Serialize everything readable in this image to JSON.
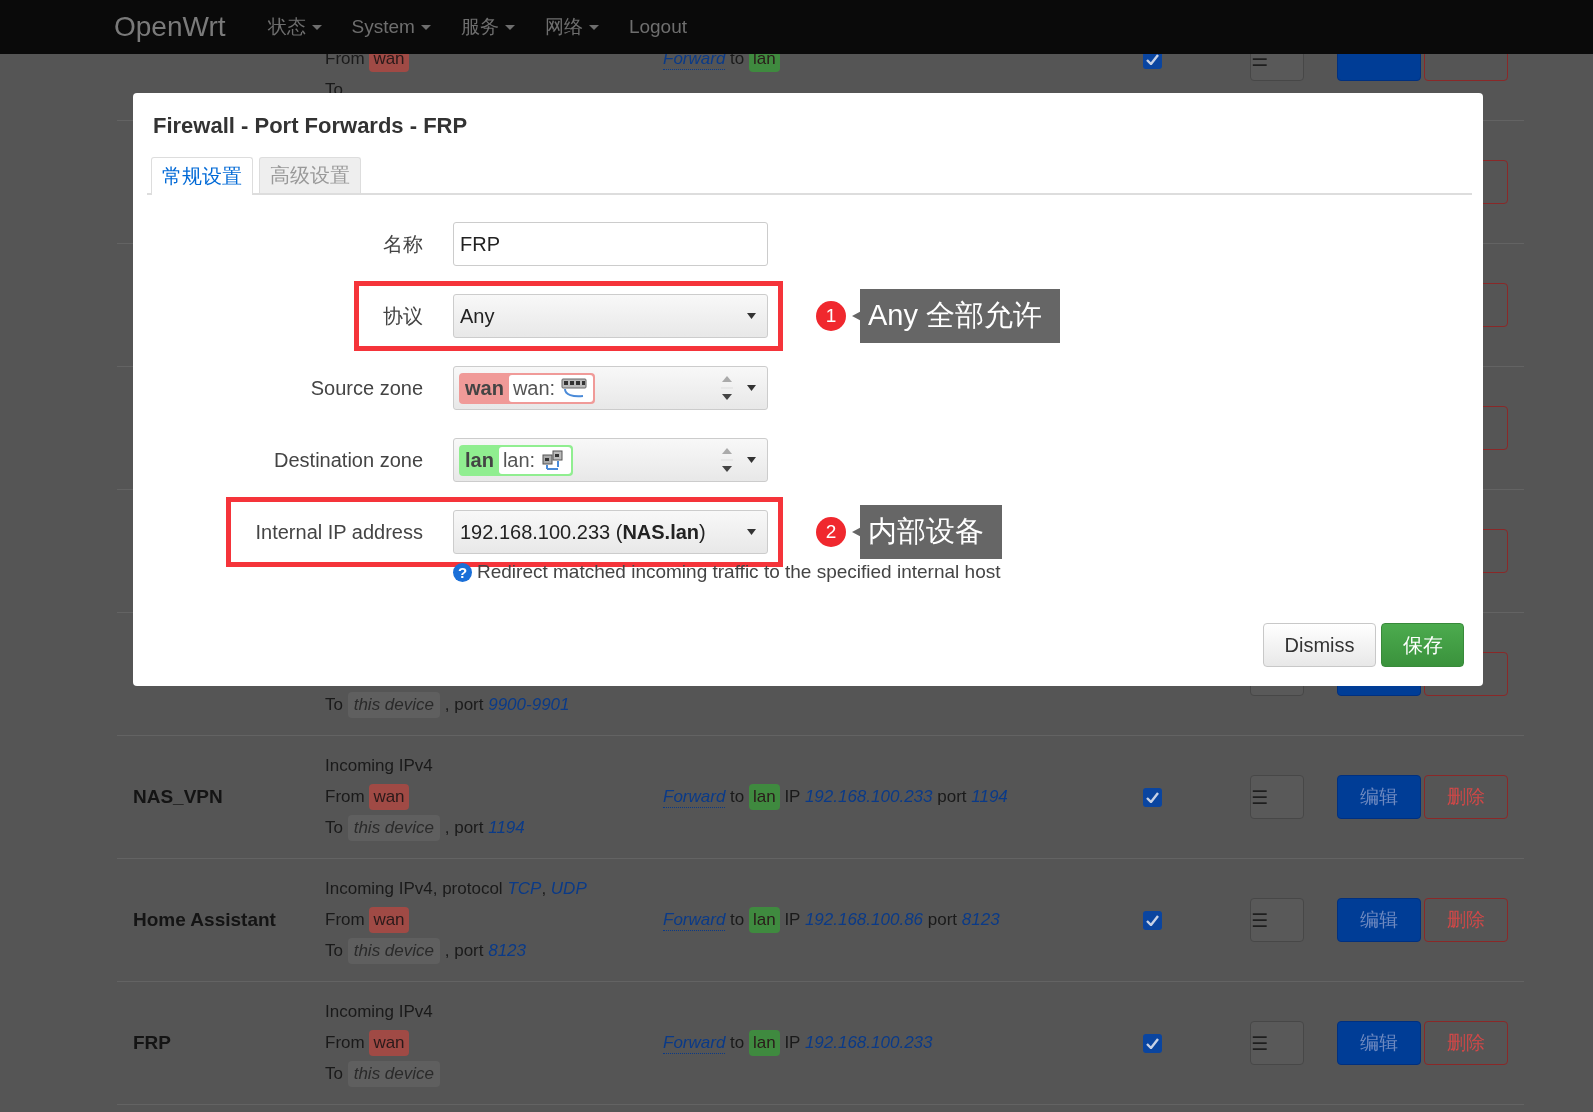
{
  "navbar": {
    "brand": "OpenWrt",
    "menu": [
      {
        "label": "状态",
        "dropdown": true
      },
      {
        "label": "System",
        "dropdown": true
      },
      {
        "label": "服务",
        "dropdown": true
      },
      {
        "label": "网络",
        "dropdown": true
      },
      {
        "label": "Logout",
        "dropdown": false
      }
    ]
  },
  "rules": [
    {
      "kind": "rule",
      "from": [
        {
          "kind": "text",
          "text": "From "
        },
        {
          "kind": "zone",
          "text": "wan",
          "color": "#a04a45"
        }
      ],
      "to": [
        {
          "kind": "text",
          "text": "To "
        }
      ],
      "action": [
        {
          "kind": "link",
          "text": "Forward"
        },
        {
          "kind": "text",
          "text": " to "
        },
        {
          "kind": "zone",
          "text": "lan",
          "color": "#3f8a3f"
        }
      ],
      "enabled": true,
      "buttons": [
        {
          "kind": "menu",
          "label": "☰"
        },
        {
          "kind": "edit"
        },
        {
          "kind": "delete"
        }
      ]
    },
    {
      "kind": "covered",
      "buttons": [
        {
          "kind": "delete"
        }
      ]
    },
    {
      "kind": "covered",
      "buttons": [
        {
          "kind": "delete"
        }
      ]
    },
    {
      "kind": "covered",
      "buttons": [
        {
          "kind": "delete"
        }
      ]
    },
    {
      "kind": "covered",
      "buttons": [
        {
          "kind": "delete"
        }
      ]
    },
    {
      "kind": "rule",
      "to": [
        {
          "kind": "text",
          "text": "To "
        },
        {
          "kind": "device",
          "text": "this device"
        },
        {
          "kind": "text",
          "text": " , port "
        },
        {
          "kind": "value",
          "text": "9900-9901"
        }
      ],
      "buttons": [
        {
          "kind": "menu"
        },
        {
          "kind": "edit"
        },
        {
          "kind": "delete"
        }
      ]
    },
    {
      "kind": "rule",
      "name": "NAS_VPN",
      "incoming": [
        {
          "kind": "text",
          "text": "Incoming IPv4"
        }
      ],
      "from": [
        {
          "kind": "text",
          "text": "From "
        },
        {
          "kind": "zone",
          "text": "wan",
          "color": "#a04a45"
        }
      ],
      "to": [
        {
          "kind": "text",
          "text": "To "
        },
        {
          "kind": "device",
          "text": "this device"
        },
        {
          "kind": "text",
          "text": " , port "
        },
        {
          "kind": "value",
          "text": "1194"
        }
      ],
      "action": [
        {
          "kind": "link",
          "text": "Forward"
        },
        {
          "kind": "text",
          "text": " to "
        },
        {
          "kind": "zone",
          "text": "lan",
          "color": "#3f8a3f"
        },
        {
          "kind": "text",
          "text": " IP "
        },
        {
          "kind": "value",
          "text": "192.168.100.233"
        },
        {
          "kind": "text",
          "text": " port "
        },
        {
          "kind": "value",
          "text": "1194"
        }
      ],
      "enabled": true,
      "buttons": [
        {
          "kind": "menu",
          "label": "☰"
        },
        {
          "kind": "edit",
          "label": "编辑"
        },
        {
          "kind": "delete",
          "label": "删除"
        }
      ]
    },
    {
      "kind": "rule",
      "name": "Home Assistant",
      "incoming": [
        {
          "kind": "text",
          "text": "Incoming IPv4, protocol "
        },
        {
          "kind": "value",
          "text": "TCP"
        },
        {
          "kind": "text",
          "text": ", "
        },
        {
          "kind": "value",
          "text": "UDP"
        }
      ],
      "from": [
        {
          "kind": "text",
          "text": "From "
        },
        {
          "kind": "zone",
          "text": "wan",
          "color": "#a04a45"
        }
      ],
      "to": [
        {
          "kind": "text",
          "text": "To "
        },
        {
          "kind": "device",
          "text": "this device"
        },
        {
          "kind": "text",
          "text": " , port "
        },
        {
          "kind": "value",
          "text": "8123"
        }
      ],
      "action": [
        {
          "kind": "link",
          "text": "Forward"
        },
        {
          "kind": "text",
          "text": " to "
        },
        {
          "kind": "zone",
          "text": "lan",
          "color": "#3f8a3f"
        },
        {
          "kind": "text",
          "text": " IP "
        },
        {
          "kind": "value",
          "text": "192.168.100.86"
        },
        {
          "kind": "text",
          "text": " port "
        },
        {
          "kind": "value",
          "text": "8123"
        }
      ],
      "enabled": true,
      "buttons": [
        {
          "kind": "menu",
          "label": "☰"
        },
        {
          "kind": "edit",
          "label": "编辑"
        },
        {
          "kind": "delete",
          "label": "删除"
        }
      ]
    },
    {
      "kind": "rule",
      "name": "FRP",
      "incoming": [
        {
          "kind": "text",
          "text": "Incoming IPv4"
        }
      ],
      "from": [
        {
          "kind": "text",
          "text": "From "
        },
        {
          "kind": "zone",
          "text": "wan",
          "color": "#a04a45"
        }
      ],
      "to": [
        {
          "kind": "text",
          "text": "To "
        },
        {
          "kind": "device",
          "text": "this device"
        }
      ],
      "action": [
        {
          "kind": "link",
          "text": "Forward"
        },
        {
          "kind": "text",
          "text": " to "
        },
        {
          "kind": "zone",
          "text": "lan",
          "color": "#3f8a3f"
        },
        {
          "kind": "text",
          "text": " IP "
        },
        {
          "kind": "value",
          "text": "192.168.100.233"
        }
      ],
      "enabled": true,
      "buttons": [
        {
          "kind": "menu",
          "label": "☰"
        },
        {
          "kind": "edit",
          "label": "编辑"
        },
        {
          "kind": "delete",
          "label": "删除"
        }
      ]
    }
  ],
  "modal": {
    "title": "Firewall - Port Forwards - FRP",
    "tabs": [
      {
        "label": "常规设置",
        "selected": true
      },
      {
        "label": "高级设置",
        "selected": false
      }
    ],
    "fields": [
      {
        "kind": "text",
        "label": "名称",
        "value": "FRP"
      },
      {
        "kind": "select",
        "label": "协议",
        "value": "Any",
        "annotation": {
          "number": "1",
          "text": "Any 全部允许"
        }
      },
      {
        "kind": "zone",
        "label": "Source zone",
        "zone": "wan",
        "chip": "wan:",
        "color": "#f09a98"
      },
      {
        "kind": "zone",
        "label": "Destination zone",
        "zone": "lan",
        "chip": "lan:",
        "color": "#90ee90"
      },
      {
        "kind": "select",
        "label": "Internal IP address",
        "value": "192.168.100.233 (**NAS.lan**)",
        "annotation": {
          "number": "2",
          "text": "内部设备"
        },
        "help_icon": "?",
        "help": "Redirect matched incoming traffic to the specified internal host"
      }
    ],
    "buttons": [
      {
        "kind": "default",
        "label": "Dismiss"
      },
      {
        "kind": "primary",
        "label": "保存"
      }
    ]
  }
}
